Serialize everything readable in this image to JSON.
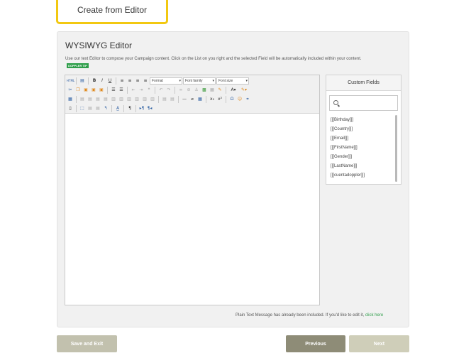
{
  "top_tab": {
    "label": "Create from Editor"
  },
  "panel": {
    "title": "WYSIWYG Editor",
    "description": "Use our text Editor to compose your Campaign content. Click on the List on you right and the selected Field will be automatically included within your content.",
    "tip_badge": "DOPPLER TIP"
  },
  "toolbar": {
    "html_button": "HTML",
    "format_select": "Format",
    "font_family_select": "Font family",
    "font_size_select": "Font size",
    "omega_button": "Ω",
    "para_button": "¶"
  },
  "custom_fields": {
    "header": "Custom Fields",
    "search_placeholder": "",
    "items": [
      "[[[Birthday]]]",
      "[[[Country]]]",
      "[[[Email]]]",
      "[[[FirstName]]]",
      "[[[Gender]]]",
      "[[[LastName]]]",
      "[[[cuentadoppler]]]"
    ]
  },
  "plain_text": {
    "message": "Plain Text Message has already been included. If you'd like to edit it,",
    "link": "click here"
  },
  "buttons": {
    "save_exit": "Save and Exit",
    "previous": "Previous",
    "next": "Next"
  }
}
